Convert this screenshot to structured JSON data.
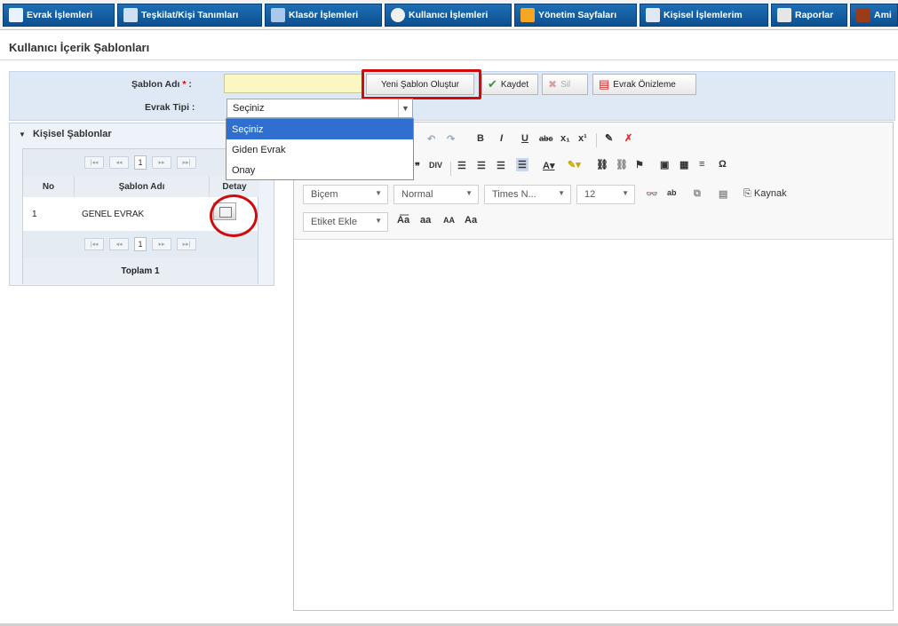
{
  "nav": {
    "items": [
      {
        "label": "Evrak İşlemleri",
        "icon": "document-icon"
      },
      {
        "label": "Teşkilat/Kişi Tanımları",
        "icon": "org-chart-icon"
      },
      {
        "label": "Klasör İşlemleri",
        "icon": "folder-icon"
      },
      {
        "label": "Kullanıcı İşlemleri",
        "icon": "user-icon"
      },
      {
        "label": "Yönetim Sayfaları",
        "icon": "admin-icon"
      },
      {
        "label": "Kişisel İşlemlerim",
        "icon": "person-tools-icon"
      },
      {
        "label": "Raporlar",
        "icon": "report-icon"
      },
      {
        "label": "Ami",
        "icon": "supervisor-icon"
      }
    ]
  },
  "page": {
    "title": "Kullanıcı İçerik Şablonları"
  },
  "form": {
    "template_name_label": "Şablon Adı",
    "required_mark": "*",
    "colon": ":",
    "doc_type_label": "Evrak Tipi",
    "template_name_value": "",
    "doc_type_selected": "Seçiniz",
    "doc_type_options": [
      "Seçiniz",
      "Giden Evrak",
      "Onay"
    ]
  },
  "actions": {
    "new_template": "Yeni Şablon Oluştur",
    "save": "Kaydet",
    "delete": "Sil",
    "preview": "Evrak Önizleme"
  },
  "left_panel": {
    "title": "Kişisel Şablonlar",
    "page_number": "1",
    "columns": [
      "No",
      "Şablon Adı",
      "Detay"
    ],
    "rows": [
      {
        "no": "1",
        "name": "GENEL EVRAK"
      }
    ],
    "total": "Toplam 1"
  },
  "editor": {
    "format_label": "Biçem",
    "paragraph_label": "Normal",
    "font_label": "Times N...",
    "size_label": "12",
    "source_label": "Kaynak",
    "tag_label": "Etiket Ekle",
    "case_buttons": [
      "A͞a",
      "aa",
      "AA",
      "Aa"
    ]
  },
  "colors": {
    "nav_blue": "#1d6fb6",
    "highlight_red": "#d10b0b",
    "input_yellow": "#fbf6c2",
    "selected_option": "#2f6fd0"
  }
}
